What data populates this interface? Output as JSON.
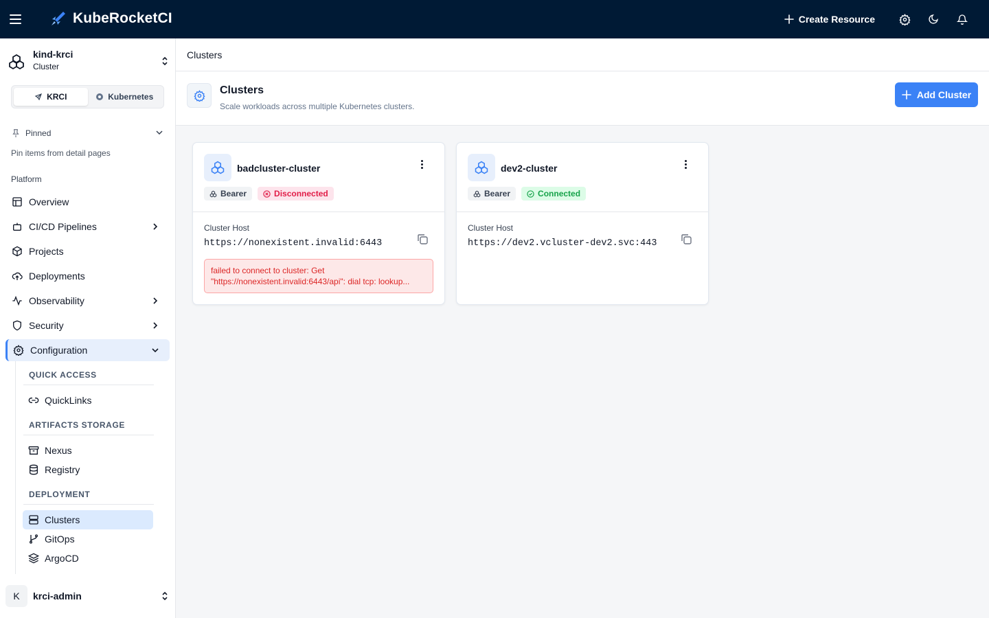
{
  "app": {
    "title": "KubeRocketCI",
    "create_resource_label": "Create Resource"
  },
  "sidebar": {
    "cluster_name": "kind-krci",
    "cluster_type": "Cluster",
    "mode_tabs": [
      {
        "label": "KRCI",
        "active": true
      },
      {
        "label": "Kubernetes",
        "active": false
      }
    ],
    "pinned_label": "Pinned",
    "pinned_hint": "Pin items from detail pages",
    "section_label": "Platform",
    "nav": [
      {
        "label": "Overview",
        "icon": "overview-icon"
      },
      {
        "label": "CI/CD Pipelines",
        "icon": "pipeline-icon"
      },
      {
        "label": "Projects",
        "icon": "projects-icon"
      },
      {
        "label": "Deployments",
        "icon": "deployments-icon"
      },
      {
        "label": "Observability",
        "icon": "activity-icon"
      },
      {
        "label": "Security",
        "icon": "shield-icon"
      },
      {
        "label": "Configuration",
        "icon": "gear-icon"
      }
    ],
    "config_groups": {
      "quick_access": "QUICK ACCESS",
      "artifacts_storage": "ARTIFACTS STORAGE",
      "deployment": "DEPLOYMENT"
    },
    "config_items": {
      "quicklinks": "QuickLinks",
      "nexus": "Nexus",
      "registry": "Registry",
      "clusters": "Clusters",
      "gitops": "GitOps",
      "argocd": "ArgoCD"
    },
    "user": {
      "initial": "K",
      "name": "krci-admin"
    }
  },
  "main": {
    "breadcrumb": "Clusters",
    "title": "Clusters",
    "subtitle": "Scale workloads across multiple Kubernetes clusters.",
    "add_button_label": "Add Cluster",
    "host_label": "Cluster Host",
    "cards": [
      {
        "name": "badcluster-cluster",
        "auth": "Bearer",
        "status": "Disconnected",
        "host": "https://nonexistent.invalid:6443",
        "error_line1": "failed to connect to cluster: Get",
        "error_line2": "\"https://nonexistent.invalid:6443/api\": dial tcp: lookup..."
      },
      {
        "name": "dev2-cluster",
        "auth": "Bearer",
        "status": "Connected",
        "host": "https://dev2.vcluster-dev2.svc:443"
      }
    ]
  },
  "colors": {
    "topbar": "#001a35",
    "accent": "#3b82f6",
    "disconnected": "#e11d48",
    "connected": "#16a34a"
  }
}
